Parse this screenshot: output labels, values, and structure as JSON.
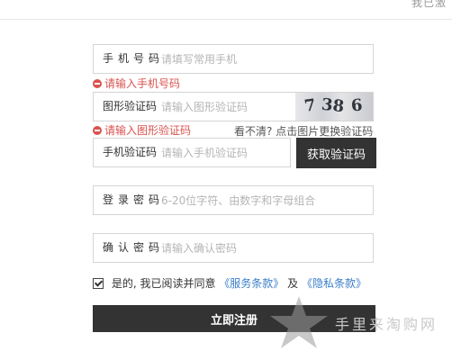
{
  "header": {
    "corner_text": "我已激"
  },
  "form": {
    "phone": {
      "label": "手机号码",
      "placeholder": "请填写常用手机"
    },
    "phone_error": "请输入手机号码",
    "captcha": {
      "label": "图形验证码",
      "placeholder": "请输入图形验证码",
      "image_chars": [
        "7",
        "38",
        "6"
      ]
    },
    "captcha_error": "请输入图形验证码",
    "captcha_hint": {
      "prefix": "看不清?",
      "link": "点击图片更换验证码"
    },
    "sms": {
      "label": "手机验证码",
      "placeholder": "请输入手机验证码",
      "button": "获取验证码"
    },
    "password": {
      "label": "登录密码",
      "placeholder": "6-20位字符、由数字和字母组合"
    },
    "confirm": {
      "label": "确认密码",
      "placeholder": "请输入确认密码"
    },
    "agreement": {
      "prefix": "是的, 我已阅读并同意",
      "terms": "《服务条款》",
      "conjunction": "及",
      "privacy": "《隐私条款》",
      "checked": true
    },
    "submit": "立即注册"
  },
  "watermark": {
    "text": "手里来淘购网"
  },
  "colors": {
    "error": "#d9534f",
    "link": "#3a7dc9",
    "button_bg": "#333333",
    "border": "#d5d5d5"
  }
}
